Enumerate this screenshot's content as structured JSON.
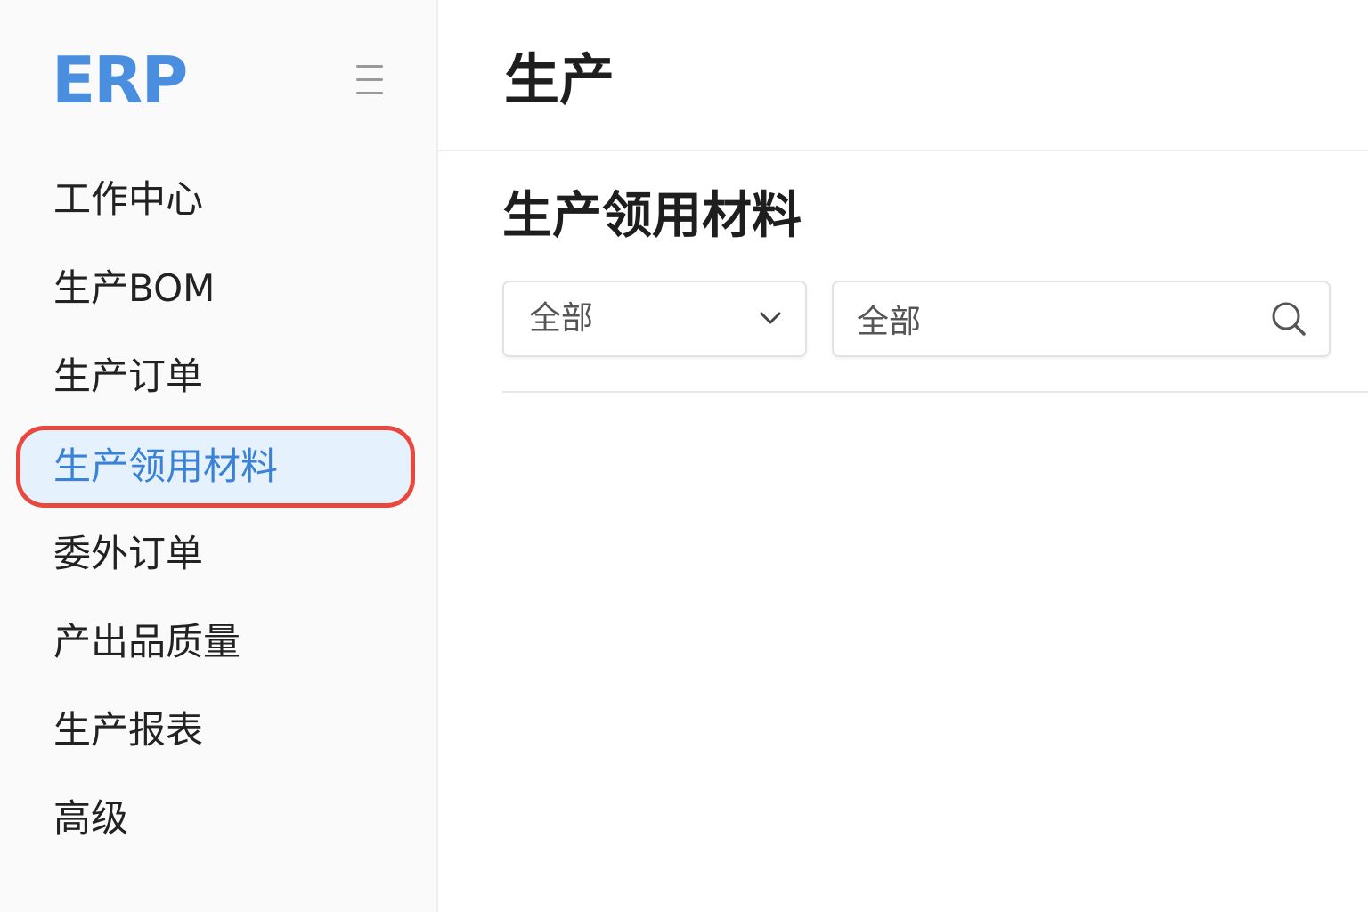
{
  "app": {
    "logo": "ERP"
  },
  "sidebar": {
    "items": [
      {
        "label": "工作中心",
        "active": false
      },
      {
        "label": "生产BOM",
        "active": false
      },
      {
        "label": "生产订单",
        "active": false
      },
      {
        "label": "生产领用材料",
        "active": true
      },
      {
        "label": "委外订单",
        "active": false
      },
      {
        "label": "产出品质量",
        "active": false
      },
      {
        "label": "生产报表",
        "active": false
      },
      {
        "label": "高级",
        "active": false
      }
    ]
  },
  "header": {
    "title": "生产"
  },
  "main": {
    "section_title": "生产领用材料",
    "filter": {
      "selected": "全部"
    },
    "search": {
      "value": "全部"
    }
  },
  "icons": {
    "menu": "hamburger-menu-icon",
    "dropdown": "chevron-down-icon",
    "search": "search-icon"
  },
  "colors": {
    "brand": "#4a8ee0",
    "active_text": "#3a82d8",
    "active_bg": "#e5f1fd",
    "highlight_outline": "#e8483e"
  }
}
